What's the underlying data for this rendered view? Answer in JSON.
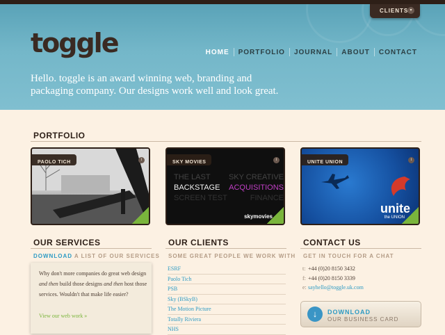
{
  "header": {
    "clients_label": "CLIENTS",
    "clients_arrow": "▾",
    "logo": "toggle",
    "nav": [
      "HOME",
      "PORTFOLIO",
      "JOURNAL",
      "ABOUT",
      "CONTACT"
    ],
    "tagline": "Hello. toggle is an award winning web, branding and packaging company. Our designs work well and look great."
  },
  "portfolio": {
    "title": "PORTFOLIO",
    "items": [
      {
        "caption": "PAOLO TICH",
        "info": "i"
      },
      {
        "caption": "SKY MOVIES",
        "info": "i",
        "lines": [
          "THE LAST",
          "SKY CREATIVE",
          "BACKSTAGE",
          "ACQUISITIONS",
          "SCREEN TEST",
          "FINANCE"
        ],
        "brand": "skymovies"
      },
      {
        "caption": "UNITE UNION",
        "info": "i",
        "brand": "unite",
        "brand_sub": "the UNION"
      }
    ]
  },
  "services": {
    "title": "OUR SERVICES",
    "sub_highlight": "DOWNLOAD",
    "sub_rest": " A LIST OF OUR SERVICES",
    "body_1": "Why don't more companies do great web design ",
    "body_em1": "and then",
    "body_2": " build those designs ",
    "body_em2": "and then",
    "body_3": " host those services. Wouldn't that make life easier?",
    "link": "View our web work »"
  },
  "clients": {
    "title": "OUR CLIENTS",
    "sub": "SOME GREAT PEOPLE WE WORK WITH",
    "list": [
      "ESRF",
      "Paolo Tich",
      "PSB",
      "Sky (BSkyB)",
      "The Motion Picture",
      "Totally Riviera",
      "NHS"
    ]
  },
  "contact": {
    "title": "CONTACT US",
    "sub": "GET IN TOUCH FOR A CHAT",
    "t_key": "t:",
    "t_val": "+44 (0)20 8150 3432",
    "f_key": "f:",
    "f_val": "+44 (0)20 8150 3339",
    "e_key": "e:",
    "e_val": "sayhello@toggle.uk.com",
    "button_line1": "DOWNLOAD",
    "button_line2": "OUR BUSINESS CARD",
    "button_icon": "download-icon"
  }
}
